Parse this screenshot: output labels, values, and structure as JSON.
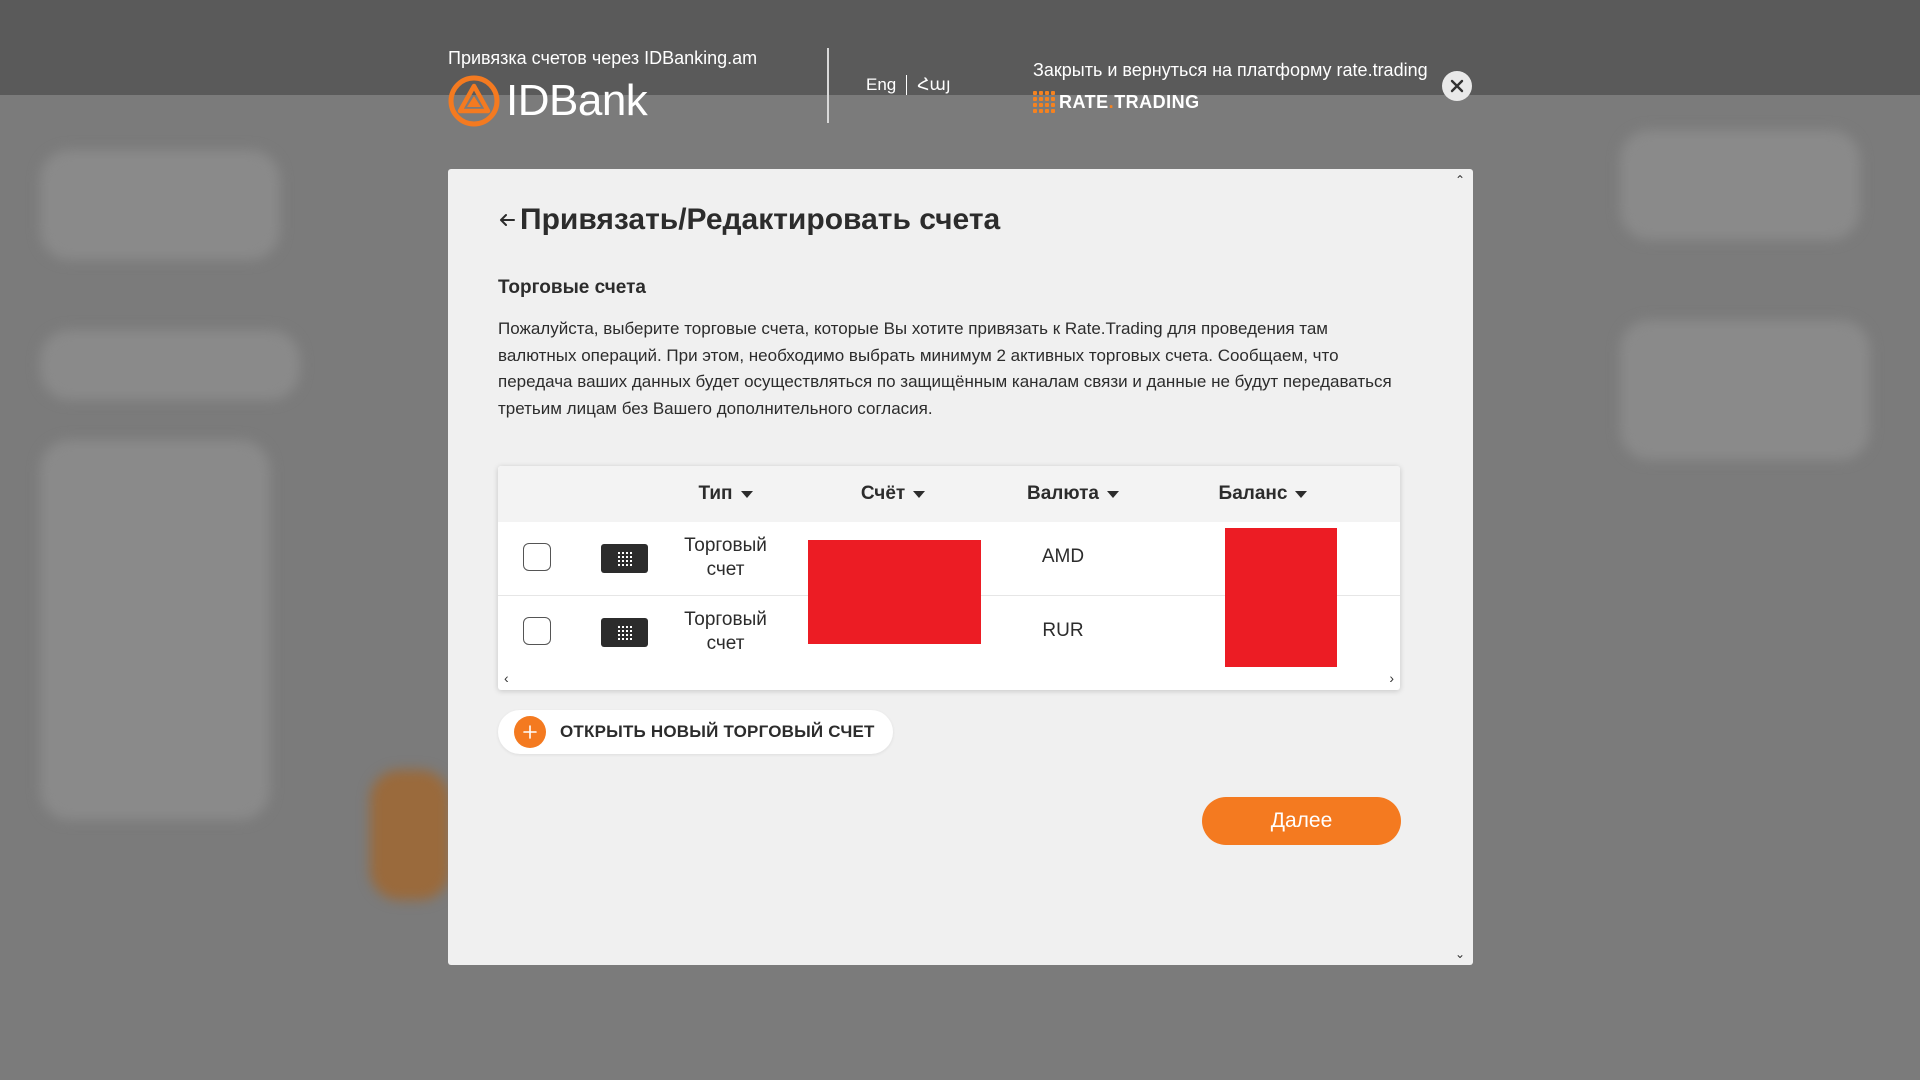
{
  "header": {
    "caption": "Привязка счетов через IDBanking.am",
    "bank_name": "IDBank",
    "languages": [
      "Eng",
      "Հայ"
    ],
    "return_link": "Закрыть и вернуться на платформу rate.trading",
    "platform_logo": {
      "main": "RATE",
      "dot": ".",
      "rest": "TRADING"
    },
    "close_icon": "close-icon"
  },
  "modal": {
    "title": "Привязать/Редактировать счета",
    "section_title": "Торговые счета",
    "description": "Пожалуйста, выберите торговые счета, которые Вы хотите привязать к Rate.Trading для проведения там валютных операций. При этом, необходимо выбрать минимум 2 активных торговых счета. Сообщаем, что передача ваших данных будет осуществляться по защищённым каналам связи и данные не будут передаваться третьим лицам без Вашего дополнительного согласия.",
    "table": {
      "columns": [
        "Тип",
        "Счёт",
        "Валюта",
        "Баланс"
      ],
      "rows": [
        {
          "type": "Торговый счет",
          "currency": "AMD"
        },
        {
          "type": "Торговый счет",
          "currency": "RUR"
        }
      ]
    },
    "open_account_label": "ОТКРЫТЬ НОВЫЙ ТОРГОВЫЙ СЧЕТ",
    "next_label": "Далее"
  },
  "colors": {
    "accent": "#f47a20",
    "redaction": "#ec1c24",
    "modal_bg": "#f0f0f0",
    "overlay": "#7b7b7b"
  }
}
